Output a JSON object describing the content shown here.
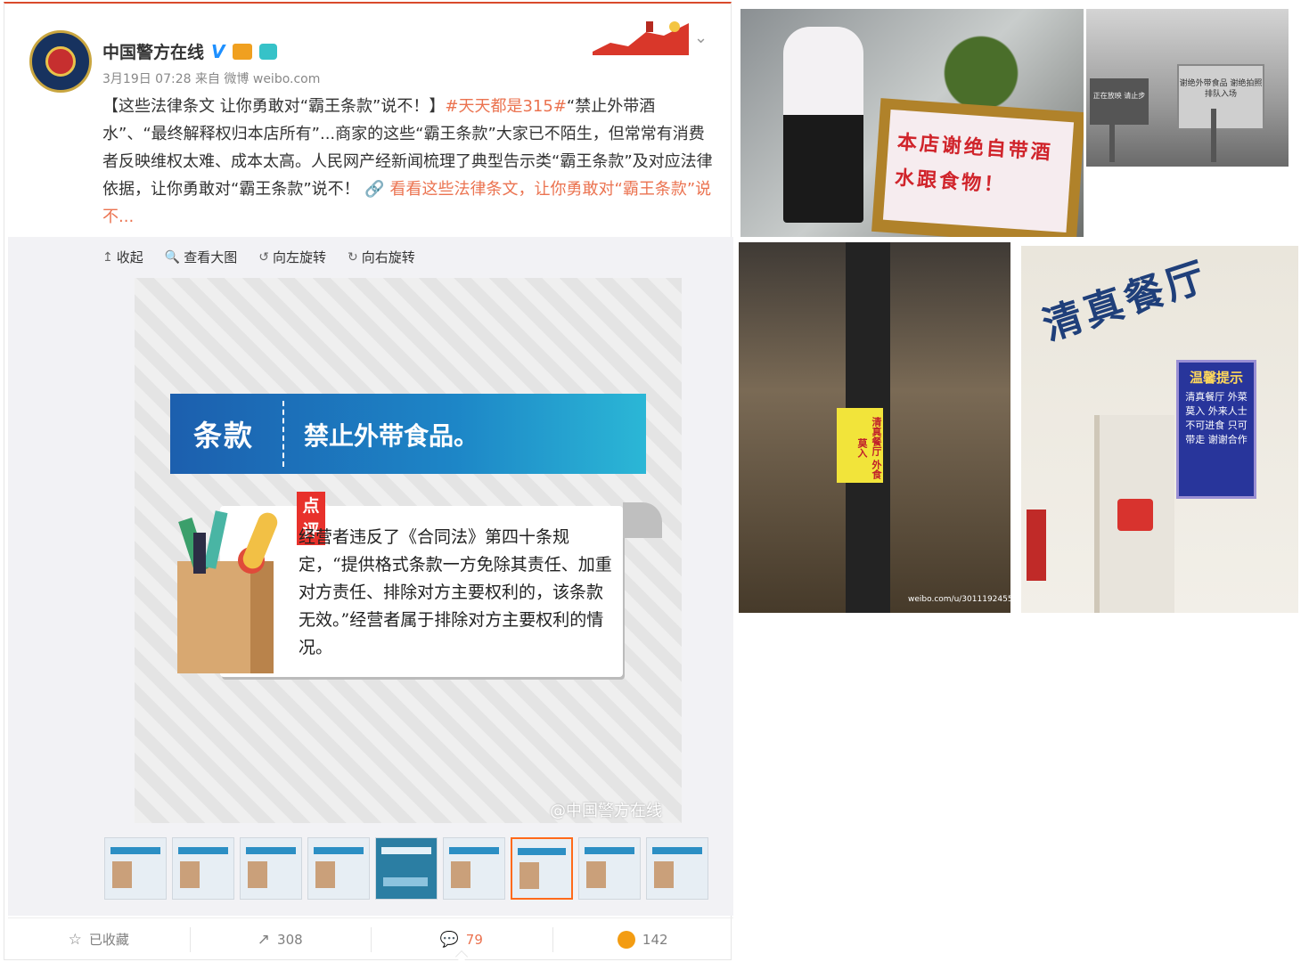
{
  "post": {
    "username": "中国警方在线",
    "verified_badge": "V",
    "meta": "3月19日 07:28 来自 微博 weibo.com",
    "text": {
      "part1": "【这些法律条文 让你勇敢对“霸王条款”说不！】",
      "hashtag": "#天天都是315#",
      "part2": "“禁止外带酒水”、“最终解释权归本店所有”...商家的这些“霸王条款”大家已不陌生，但常常有消费者反映维权太难、成本太高。人民网产经新闻梳理了典型告示类“霸王条款”及对应法律依据，让你勇敢对“霸王条款”说不！ ",
      "link_icon": "🔗",
      "link": "看看这些法律条文，让你勇敢对“霸王条款”说不..."
    }
  },
  "toolbar": {
    "collapse_icon": "↥",
    "collapse": "收起",
    "view_large_icon": "🔍",
    "view_large": "查看大图",
    "rotate_left_icon": "↺",
    "rotate_left": "向左旋转",
    "rotate_right_icon": "↻",
    "rotate_right": "向右旋转"
  },
  "image": {
    "banner_key": "条款",
    "banner_value": "禁止外带食品。",
    "tag": "点评",
    "comment": "经营者违反了《合同法》第四十条规定，“提供格式条款一方免除其责任、加重对方责任、排除对方主要权利的，该条款无效。”经营者属于排除对方主要权利的情况。",
    "watermark": "@中国警方在线"
  },
  "thumbnails": {
    "count": 9,
    "active_index": 6
  },
  "actions": {
    "favorite_icon": "☆",
    "favorite": "已收藏",
    "repost_icon": "↗",
    "repost": "308",
    "comment_icon": "💬",
    "comment": "79",
    "like": "142"
  },
  "photos": {
    "sign1": "本店谢绝自带酒水跟食物！",
    "sign2_a": "正在放映 请止步",
    "sign2_b": "谢绝外带食品 谢绝拍照 排队入场",
    "sign3": "清真餐厅 外食莫入",
    "credit3": "weibo.com/u/3011192455",
    "title4": "清真餐厅",
    "notice_title": "温馨提示",
    "notice_body": "清真餐厅 外菜莫入 外来人士 不可进食 只可带走 谢谢合作"
  },
  "colors": {
    "accent": "#eb7350",
    "banner": "#1d86c7",
    "verified": "#1e90ff"
  }
}
